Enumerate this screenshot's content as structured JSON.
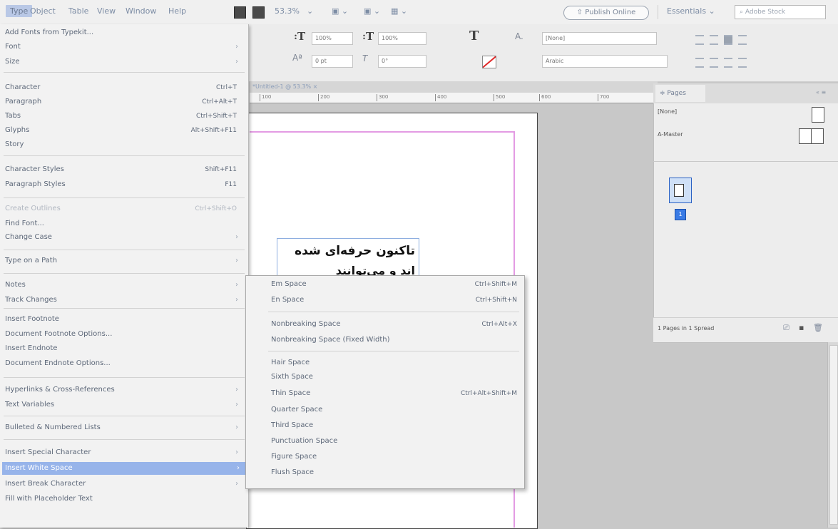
{
  "menubar": {
    "items": [
      "Type",
      "Object",
      "Table",
      "View",
      "Window",
      "Help"
    ],
    "zoom": "53.3%",
    "publish": "Publish Online",
    "workspace": "Essentials",
    "search_placeholder": "Adobe Stock"
  },
  "control": {
    "tracking_field": "100%",
    "vscale_field": "100%",
    "leading_field": "0 pt",
    "angle_field": "0°",
    "char_style": "[None]",
    "lang": "Arabic"
  },
  "document": {
    "tab": "*Untitled-1 @ 53.3% ×",
    "ruler_ticks": [
      "100",
      "200",
      "300",
      "400",
      "500",
      "600",
      "700"
    ],
    "arabic_line1": "تاکنون حرفه‌ای شده",
    "arabic_line2": "اند و می‌توانند"
  },
  "pages_panel": {
    "tab": "≑ Pages",
    "none_row": "[None]",
    "master_row": "A-Master",
    "page_number": "1",
    "footer": "1 Pages in 1 Spread"
  },
  "main_menu": {
    "items": [
      {
        "label": "Add Fonts from Typekit...",
        "shortcut": "",
        "arrow": false
      },
      {
        "label": "Font",
        "shortcut": "",
        "arrow": true
      },
      {
        "label": "Size",
        "shortcut": "",
        "arrow": true
      },
      {
        "label": "Character",
        "shortcut": "Ctrl+T",
        "arrow": false
      },
      {
        "label": "Paragraph",
        "shortcut": "Ctrl+Alt+T",
        "arrow": false
      },
      {
        "label": "Tabs",
        "shortcut": "Ctrl+Shift+T",
        "arrow": false
      },
      {
        "label": "Glyphs",
        "shortcut": "Alt+Shift+F11",
        "arrow": false
      },
      {
        "label": "Story",
        "shortcut": "",
        "arrow": false
      },
      {
        "label": "Character Styles",
        "shortcut": "Shift+F11",
        "arrow": false
      },
      {
        "label": "Paragraph Styles",
        "shortcut": "F11",
        "arrow": false
      },
      {
        "label": "Create Outlines",
        "shortcut": "Ctrl+Shift+O",
        "arrow": false,
        "disabled": true
      },
      {
        "label": "Find Font...",
        "shortcut": "",
        "arrow": false
      },
      {
        "label": "Change Case",
        "shortcut": "",
        "arrow": true
      },
      {
        "label": "Type on a Path",
        "shortcut": "",
        "arrow": true
      },
      {
        "label": "Notes",
        "shortcut": "",
        "arrow": true
      },
      {
        "label": "Track Changes",
        "shortcut": "",
        "arrow": true
      },
      {
        "label": "Insert Footnote",
        "shortcut": "",
        "arrow": false
      },
      {
        "label": "Document Footnote Options...",
        "shortcut": "",
        "arrow": false
      },
      {
        "label": "Insert Endnote",
        "shortcut": "",
        "arrow": false
      },
      {
        "label": "Document Endnote Options...",
        "shortcut": "",
        "arrow": false
      },
      {
        "label": "Hyperlinks & Cross-References",
        "shortcut": "",
        "arrow": true
      },
      {
        "label": "Text Variables",
        "shortcut": "",
        "arrow": true
      },
      {
        "label": "Bulleted & Numbered Lists",
        "shortcut": "",
        "arrow": true
      },
      {
        "label": "Insert Special Character",
        "shortcut": "",
        "arrow": true
      },
      {
        "label": "Insert White Space",
        "shortcut": "",
        "arrow": true,
        "highlighted": true
      },
      {
        "label": "Insert Break Character",
        "shortcut": "",
        "arrow": true
      },
      {
        "label": "Fill with Placeholder Text",
        "shortcut": "",
        "arrow": false
      }
    ]
  },
  "submenu": {
    "items": [
      {
        "label": "Em Space",
        "shortcut": "Ctrl+Shift+M"
      },
      {
        "label": "En Space",
        "shortcut": "Ctrl+Shift+N"
      },
      {
        "label": "Nonbreaking Space",
        "shortcut": "Ctrl+Alt+X"
      },
      {
        "label": "Nonbreaking Space (Fixed Width)",
        "shortcut": ""
      },
      {
        "label": "Hair Space",
        "shortcut": ""
      },
      {
        "label": "Sixth Space",
        "shortcut": ""
      },
      {
        "label": "Thin Space",
        "shortcut": "Ctrl+Alt+Shift+M"
      },
      {
        "label": "Quarter Space",
        "shortcut": ""
      },
      {
        "label": "Third Space",
        "shortcut": ""
      },
      {
        "label": "Punctuation Space",
        "shortcut": ""
      },
      {
        "label": "Figure Space",
        "shortcut": ""
      },
      {
        "label": "Flush Space",
        "shortcut": ""
      }
    ]
  }
}
